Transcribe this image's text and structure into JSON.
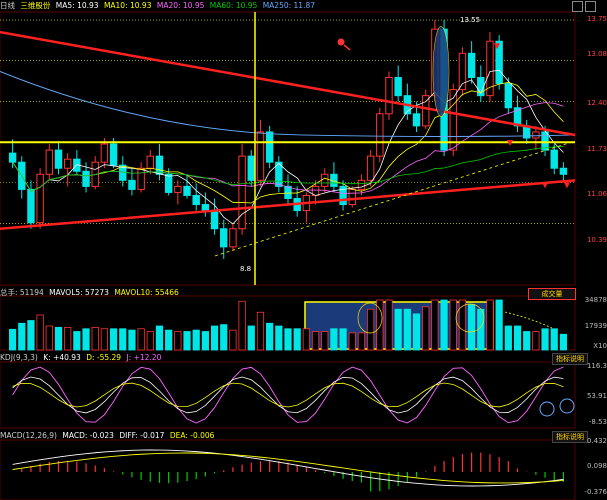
{
  "main_header": {
    "period": "日线",
    "stock": "三维股份",
    "ma5": "MA5: 10.93",
    "ma10": "MA10: 10.93",
    "ma20": "MA20: 10.95",
    "ma60": "MA60: 10.95",
    "ma250": "MA250: 11.87"
  },
  "price_axis": [
    "13.75",
    "13.08",
    "12.40",
    "11.73",
    "11.06",
    "10.39"
  ],
  "annotations": {
    "high": "13.55",
    "low": "8.8"
  },
  "volume_header": {
    "label": "总手: 51194",
    "mavol5": "MAVOL5: 57273",
    "mavol10": "MAVOL10: 55466",
    "button": "成交量"
  },
  "volume_axis": [
    "34878",
    "17939",
    "X10"
  ],
  "kdj_header": {
    "label": "KDJ(9,3,3)",
    "k": "K: +40.93",
    "d": "D: -55.29",
    "j": "J: +12.20",
    "button": "指标说明"
  },
  "kdj_axis": [
    "116.3",
    "53.91",
    "-8.53"
  ],
  "macd_header": {
    "label": "MACD(12,26,9)",
    "macd": "MACD: -0.023",
    "diff": "DIFF: -0.017",
    "dea": "DEA: -0.006",
    "button": "指标说明"
  },
  "macd_axis": [
    "0.432",
    "0.098",
    "-0.376"
  ],
  "colors": {
    "up": "#ff3333",
    "down": "#00e5e5",
    "trend": "#ff2020",
    "yellow": "#ffff00",
    "ma5": "#ffffff",
    "ma10": "#ffff00",
    "ma20": "#ff66ff",
    "ma60": "#00cc00",
    "ma250": "#66aaff"
  },
  "chart_data": {
    "type": "candlestick",
    "series": [
      {
        "name": "K线",
        "ohlc": [
          [
            11.55,
            11.78,
            11.3,
            11.4
          ],
          [
            11.4,
            11.5,
            10.8,
            10.95
          ],
          [
            10.95,
            11.1,
            10.3,
            10.4
          ],
          [
            10.4,
            11.3,
            10.3,
            11.2
          ],
          [
            11.2,
            11.7,
            11.1,
            11.6
          ],
          [
            11.6,
            11.75,
            11.2,
            11.3
          ],
          [
            11.3,
            11.55,
            11.0,
            11.45
          ],
          [
            11.45,
            11.6,
            11.2,
            11.25
          ],
          [
            11.25,
            11.4,
            10.9,
            11.0
          ],
          [
            11.0,
            11.5,
            10.95,
            11.4
          ],
          [
            11.4,
            11.8,
            11.3,
            11.7
          ],
          [
            11.7,
            11.8,
            11.3,
            11.35
          ],
          [
            11.35,
            11.5,
            11.0,
            11.1
          ],
          [
            11.1,
            11.3,
            10.85,
            10.95
          ],
          [
            10.95,
            11.4,
            10.9,
            11.3
          ],
          [
            11.3,
            11.6,
            11.2,
            11.5
          ],
          [
            11.5,
            11.7,
            11.1,
            11.2
          ],
          [
            11.2,
            11.3,
            10.85,
            10.9
          ],
          [
            10.9,
            11.1,
            10.7,
            11.0
          ],
          [
            11.0,
            11.2,
            10.8,
            10.85
          ],
          [
            10.85,
            11.05,
            10.6,
            10.7
          ],
          [
            10.7,
            10.9,
            10.5,
            10.6
          ],
          [
            10.6,
            10.8,
            10.2,
            10.3
          ],
          [
            10.3,
            10.45,
            9.8,
            10.0
          ],
          [
            10.0,
            10.4,
            9.95,
            10.3
          ],
          [
            10.3,
            11.7,
            10.2,
            11.5
          ],
          [
            11.5,
            11.6,
            11.0,
            11.1
          ],
          [
            11.1,
            12.1,
            11.0,
            11.9
          ],
          [
            11.9,
            12.0,
            11.3,
            11.4
          ],
          [
            11.4,
            11.5,
            10.9,
            11.0
          ],
          [
            11.0,
            11.2,
            10.7,
            10.8
          ],
          [
            10.8,
            11.0,
            10.5,
            10.6
          ],
          [
            10.6,
            10.9,
            10.4,
            10.85
          ],
          [
            10.85,
            11.1,
            10.7,
            11.0
          ],
          [
            11.0,
            11.3,
            10.9,
            11.2
          ],
          [
            11.2,
            11.4,
            10.9,
            11.0
          ],
          [
            11.0,
            11.1,
            10.6,
            10.7
          ],
          [
            10.7,
            11.0,
            10.65,
            10.95
          ],
          [
            10.95,
            11.2,
            10.85,
            11.1
          ],
          [
            11.1,
            11.6,
            11.0,
            11.5
          ],
          [
            11.5,
            12.3,
            11.4,
            12.2
          ],
          [
            12.2,
            12.9,
            12.1,
            12.8
          ],
          [
            12.8,
            13.0,
            12.4,
            12.5
          ],
          [
            12.5,
            12.7,
            12.1,
            12.2
          ],
          [
            12.2,
            12.4,
            11.9,
            12.0
          ],
          [
            12.0,
            12.6,
            11.95,
            12.5
          ],
          [
            12.5,
            13.75,
            12.4,
            13.6
          ],
          [
            13.6,
            13.75,
            11.5,
            11.6
          ],
          [
            11.6,
            12.7,
            11.5,
            12.6
          ],
          [
            12.6,
            13.3,
            12.5,
            13.2
          ],
          [
            13.2,
            13.4,
            12.7,
            12.8
          ],
          [
            12.8,
            13.0,
            12.4,
            12.5
          ],
          [
            12.5,
            13.55,
            12.4,
            13.4
          ],
          [
            13.4,
            13.5,
            12.6,
            12.7
          ],
          [
            12.7,
            12.8,
            12.2,
            12.3
          ],
          [
            12.3,
            12.5,
            11.9,
            12.0
          ],
          [
            12.0,
            12.1,
            11.7,
            11.8
          ],
          [
            11.8,
            12.0,
            11.6,
            11.9
          ],
          [
            11.9,
            12.0,
            11.5,
            11.6
          ],
          [
            11.6,
            11.7,
            11.2,
            11.3
          ],
          [
            11.3,
            11.4,
            11.1,
            11.2
          ]
        ]
      }
    ]
  }
}
